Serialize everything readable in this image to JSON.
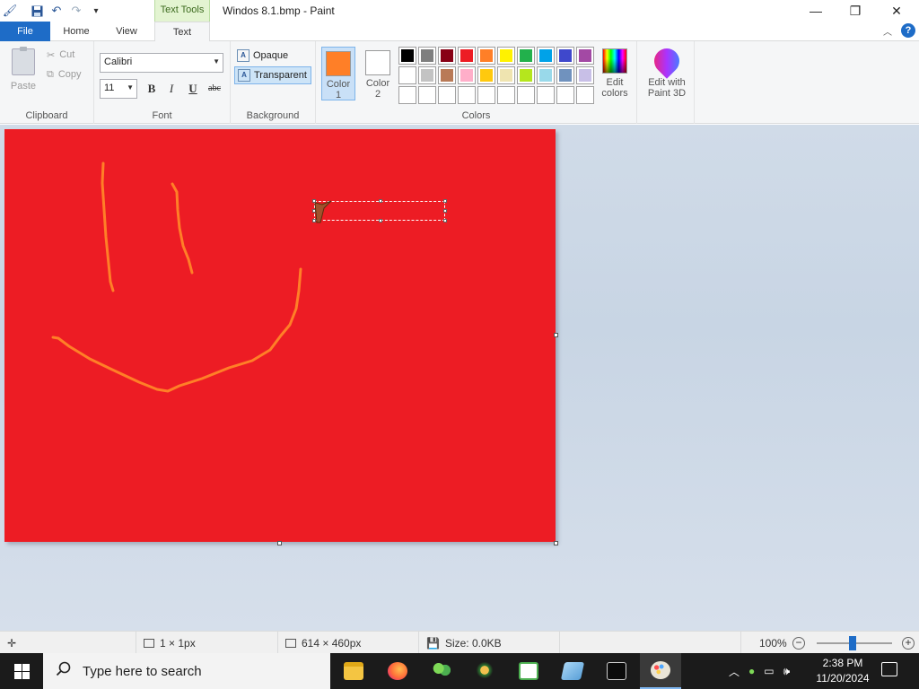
{
  "window": {
    "title": "Windos 8.1.bmp - Paint",
    "context_tab": "Text Tools",
    "controls": {
      "minimize": "—",
      "maximize": "❐",
      "close": "✕"
    }
  },
  "tabs": {
    "file": "File",
    "home": "Home",
    "view": "View",
    "text": "Text"
  },
  "ribbon": {
    "clipboard": {
      "label": "Clipboard",
      "paste": "Paste",
      "cut": "Cut",
      "copy": "Copy"
    },
    "font": {
      "label": "Font",
      "family": "Calibri",
      "size": "11",
      "bold": "B",
      "italic": "I",
      "underline": "U",
      "strikethrough": "abc"
    },
    "background": {
      "label": "Background",
      "opaque": "Opaque",
      "transparent": "Transparent"
    },
    "colors": {
      "label": "Colors",
      "color1_label": "Color\n1",
      "color1_line1": "Color",
      "color1_line2": "1",
      "color2_line1": "Color",
      "color2_line2": "2",
      "color1": "#ff7f27",
      "color2": "#ffffff",
      "palette": [
        "#000000",
        "#7f7f7f",
        "#880015",
        "#ed1c24",
        "#ff7f27",
        "#fff200",
        "#22b14c",
        "#00a2e8",
        "#3f48cc",
        "#a349a4",
        "#ffffff",
        "#c3c3c3",
        "#b97a57",
        "#ffaec9",
        "#ffc90e",
        "#efe4b0",
        "#b5e61d",
        "#99d9ea",
        "#7092be",
        "#c8bfe7",
        "",
        "",
        "",
        "",
        "",
        "",
        "",
        "",
        "",
        ""
      ],
      "edit_line1": "Edit",
      "edit_line2": "colors"
    },
    "paint3d": {
      "line1": "Edit with",
      "line2": "Paint 3D"
    }
  },
  "canvas": {
    "background": "#ed1c24",
    "stroke_color": "#ff7f27"
  },
  "status": {
    "selection": "1 × 1px",
    "image_size": "614 × 460px",
    "file_size": "Size: 0.0KB",
    "zoom": "100%",
    "zoom_level": 1.0
  },
  "taskbar": {
    "search_placeholder": "Type here to search",
    "time": "2:38 PM",
    "date": "11/20/2024"
  }
}
